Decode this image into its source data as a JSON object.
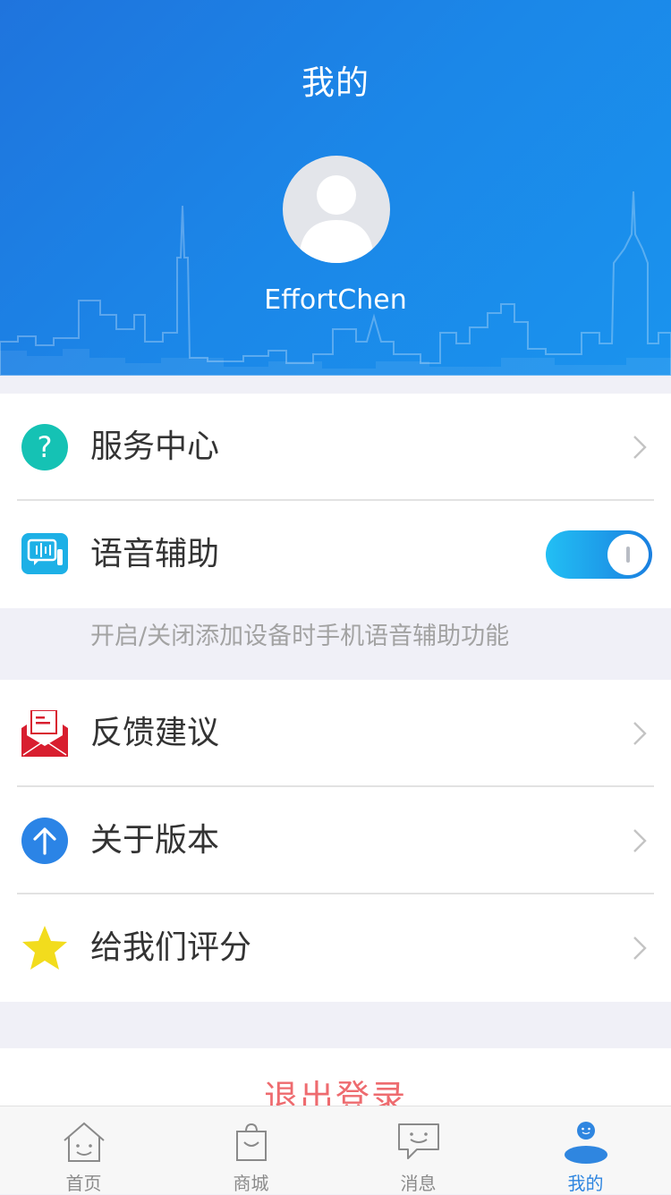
{
  "header": {
    "title": "我的",
    "username": "EffortChen"
  },
  "menu_group_1": [
    {
      "label": "服务中心",
      "icon": "question-icon"
    },
    {
      "label": "语音辅助",
      "icon": "voice-chat-icon",
      "toggle_on": true
    }
  ],
  "voice_hint": "开启/关闭添加设备时手机语音辅助功能",
  "menu_group_2": [
    {
      "label": "反馈建议",
      "icon": "mail-feedback-icon"
    },
    {
      "label": "关于版本",
      "icon": "arrow-up-icon"
    },
    {
      "label": "给我们评分",
      "icon": "star-icon"
    }
  ],
  "logout_label": "退出登录",
  "tabs": [
    {
      "label": "首页",
      "icon": "home-icon"
    },
    {
      "label": "商城",
      "icon": "shopping-bag-icon"
    },
    {
      "label": "消息",
      "icon": "message-icon"
    },
    {
      "label": "我的",
      "icon": "profile-icon",
      "active": true
    }
  ],
  "colors": {
    "header_blue": "#1f74dd",
    "accent_blue": "#2f86e0",
    "logout_red": "#ee6b6f",
    "teal": "#15c2b4",
    "star_yellow": "#f2dc1d"
  }
}
